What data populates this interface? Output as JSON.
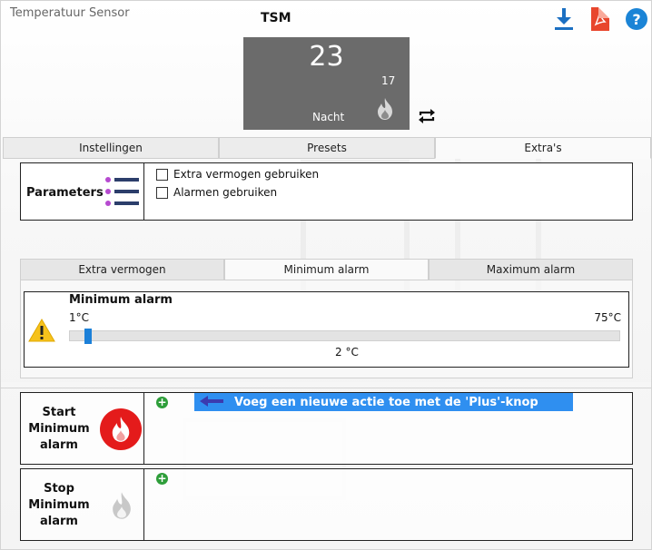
{
  "window": {
    "title": "Temperatuur Sensor"
  },
  "toolbar": {
    "download_icon": "download-icon",
    "pdf_icon": "pdf-icon",
    "help_icon": "help-icon",
    "help_glyph": "?"
  },
  "device": {
    "name": "TSM",
    "temperature": "23",
    "setpoint": "17",
    "mode": "Nacht",
    "swap_glyph": "⇄"
  },
  "tabs": [
    {
      "label": "Instellingen",
      "active": false
    },
    {
      "label": "Presets",
      "active": false
    },
    {
      "label": "Extra's",
      "active": true
    }
  ],
  "parameters": {
    "label": "Parameters",
    "options": [
      {
        "label": "Extra vermogen gebruiken",
        "checked": false
      },
      {
        "label": "Alarmen gebruiken",
        "checked": false
      }
    ]
  },
  "sub_tabs": [
    {
      "label": "Extra vermogen",
      "active": false
    },
    {
      "label": "Minimum alarm",
      "active": true
    },
    {
      "label": "Maximum alarm",
      "active": false
    }
  ],
  "alarm": {
    "title": "Minimum alarm",
    "min_label": "1°C",
    "max_label": "75°C",
    "min": 1,
    "max": 75,
    "value": 2,
    "value_label": "2 °C"
  },
  "actions": {
    "start": {
      "label_lines": [
        "Start",
        "Minimum",
        "alarm"
      ]
    },
    "stop": {
      "label_lines": [
        "Stop",
        "Minimum",
        "alarm"
      ]
    },
    "plus_glyph": "+",
    "hint": "Voeg een nieuwe actie toe met de 'Plus'-knop"
  },
  "colors": {
    "accent": "#1c80d8",
    "thermostat_bg": "#6b6b6b",
    "alarm_red": "#e41b1b",
    "add_green": "#2e9e3a",
    "hint_bg": "#2f8ff0"
  }
}
